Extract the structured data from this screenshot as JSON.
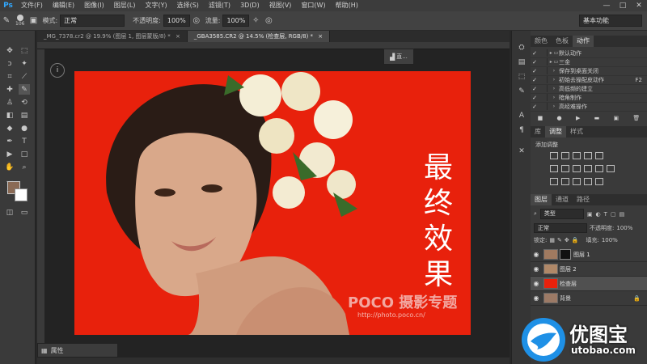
{
  "app": {
    "logo": "Ps"
  },
  "menubar": {
    "items": [
      "文件(F)",
      "编辑(E)",
      "图像(I)",
      "图层(L)",
      "文字(Y)",
      "选择(S)",
      "滤镜(T)",
      "3D(D)",
      "视图(V)",
      "窗口(W)",
      "帮助(H)"
    ],
    "minimize": "—",
    "maximize": "□",
    "close": "✕"
  },
  "options": {
    "brush_size": "106",
    "mode_label": "模式:",
    "mode_value": "正常",
    "opacity_label": "不透明度:",
    "opacity_value": "100%",
    "flow_label": "流量:",
    "flow_value": "100%",
    "workspace": "基本功能"
  },
  "tabs": [
    {
      "label": "_MG_7378.cr2 @ 19.9% (图层 1, 图层蒙版/8) *",
      "close": "×"
    },
    {
      "label": "_GBA3585.CR2 @ 14.5% (检查层, RGB/8) *",
      "close": "×"
    }
  ],
  "canvas": {
    "bg_color": "#e8210c",
    "title_vertical": [
      "最",
      "终",
      "效",
      "果"
    ],
    "watermark": "POCO 摄影专题",
    "watermark_url": "http://photo.poco.cn/",
    "info_icon": "i",
    "history_tab_label": "直..."
  },
  "properties": {
    "label": "属性"
  },
  "actions_panel": {
    "tabs": [
      "颜色",
      "色板",
      "动作"
    ],
    "active_tab": 2,
    "rows": [
      {
        "label": "默认动作",
        "key": "",
        "folder": true
      },
      {
        "label": "三金",
        "key": "",
        "folder": true
      },
      {
        "label": "保存到桌面关闭",
        "key": "",
        "folder": false
      },
      {
        "label": "初始去操配皮动作",
        "key": "F2",
        "folder": false
      },
      {
        "label": "高低频的建立",
        "key": "",
        "folder": false
      },
      {
        "label": "暗角制作",
        "key": "",
        "folder": false
      },
      {
        "label": "高经难操作",
        "key": "",
        "folder": false
      }
    ],
    "controls": [
      "■",
      "●",
      "▶",
      "▬",
      "▣",
      "🗑"
    ]
  },
  "adjust_panel": {
    "tabs": [
      "库",
      "调整",
      "样式"
    ],
    "active_tab": 1,
    "add_label": "添加调整"
  },
  "layers_panel": {
    "tabs": [
      "图层",
      "通道",
      "路径"
    ],
    "active_tab": 0,
    "filter_label": "类型",
    "blend_mode": "正常",
    "opacity_label": "不透明度:",
    "opacity_value": "100%",
    "lock_label": "锁定:",
    "fill_label": "填充:",
    "fill_value": "100%",
    "layers": [
      {
        "name": "图层 1",
        "mask": true,
        "selected": false,
        "thumb": "#a07a60",
        "lock": false
      },
      {
        "name": "图层 2",
        "mask": false,
        "selected": false,
        "thumb": "#b08868",
        "lock": false
      },
      {
        "name": "检查层",
        "mask": false,
        "selected": true,
        "thumb": "#e8210c",
        "lock": false
      },
      {
        "name": "背景",
        "mask": false,
        "selected": false,
        "thumb": "#9c7a66",
        "lock": true
      }
    ]
  },
  "site_logo": {
    "cn": "优图宝",
    "en": "utobao.com"
  }
}
